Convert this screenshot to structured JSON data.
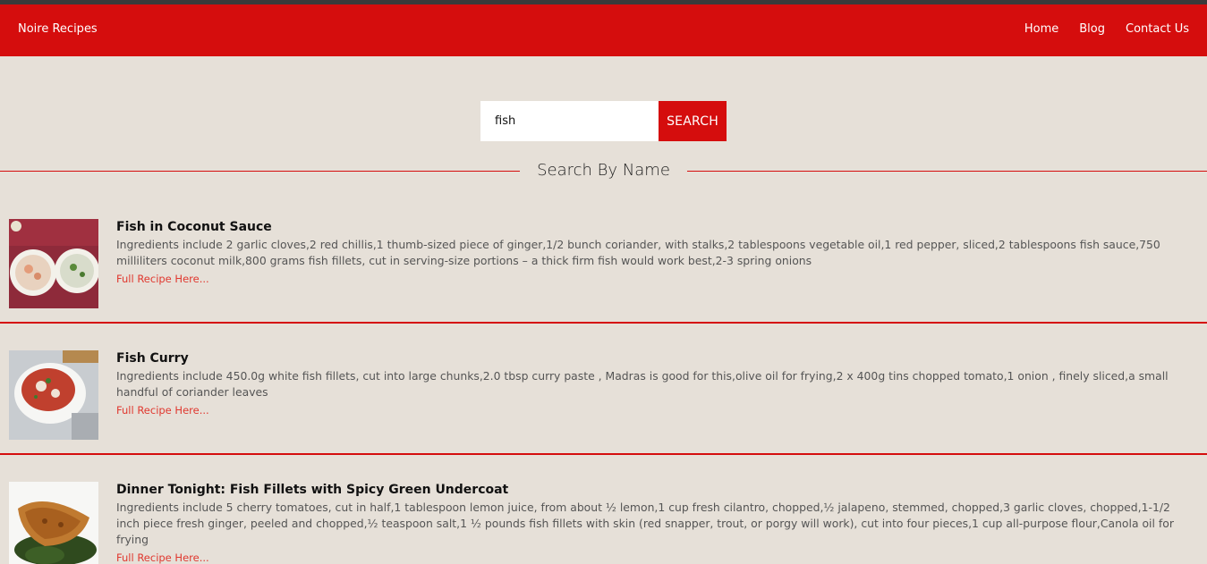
{
  "nav": {
    "brand": "Noire Recipes",
    "links": [
      "Home",
      "Blog",
      "Contact Us"
    ]
  },
  "search": {
    "value": "fish",
    "button_label": "SEARCH"
  },
  "section": {
    "title": "Search By Name"
  },
  "results": [
    {
      "title": "Fish in Coconut Sauce",
      "description": "Ingredients include 2 garlic cloves,2 red chillis,1 thumb-sized piece of ginger,1/2 bunch coriander, with stalks,2 tablespoons vegetable oil,1 red pepper, sliced,2 tablespoons fish sauce,750 milliliters coconut milk,800 grams fish fillets, cut in serving-size portions – a thick firm fish would work best,2-3 spring onions",
      "link": "Full Recipe Here..."
    },
    {
      "title": "Fish Curry",
      "description": "Ingredients include 450.0g white fish fillets, cut into large chunks,2.0 tbsp curry paste , Madras is good for this,olive oil for frying,2 x 400g tins chopped tomato,1 onion , finely sliced,a small handful of coriander leaves",
      "link": "Full Recipe Here..."
    },
    {
      "title": "Dinner Tonight: Fish Fillets with Spicy Green Undercoat",
      "description": "Ingredients include 5 cherry tomatoes, cut in half,1 tablespoon lemon juice, from about ½ lemon,1 cup fresh cilantro, chopped,½ jalapeno, stemmed, chopped,3 garlic cloves, chopped,1-1/2 inch piece fresh ginger, peeled and chopped,½ teaspoon salt,1 ½ pounds fish fillets with skin (red snapper, trout, or porgy will work), cut into four pieces,1 cup all-purpose flour,Canola oil for frying",
      "link": "Full Recipe Here..."
    }
  ]
}
